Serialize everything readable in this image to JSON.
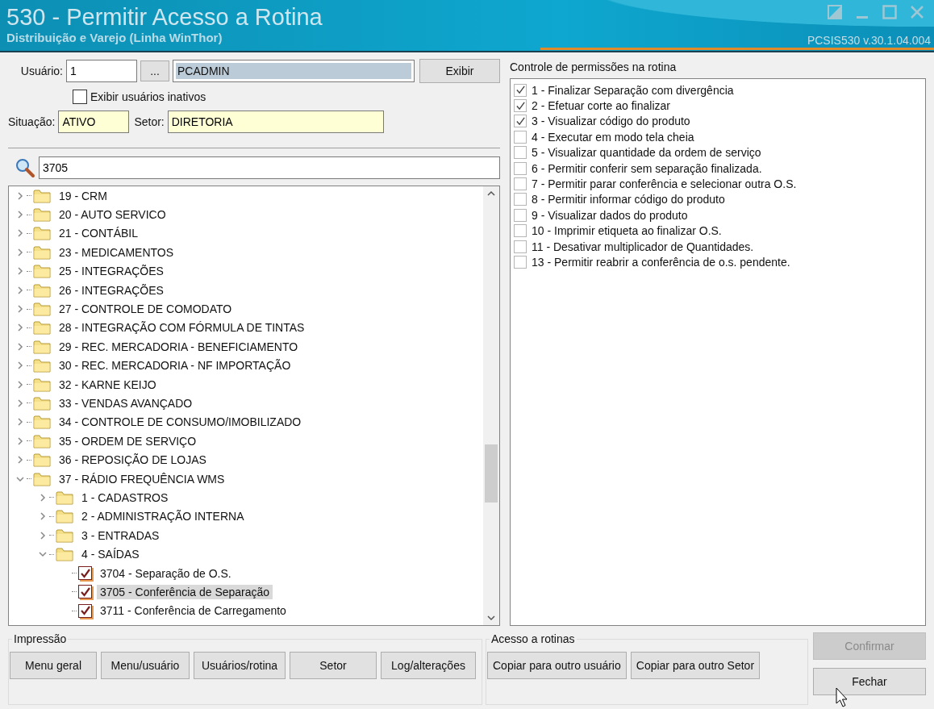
{
  "window": {
    "title": "530 - Permitir Acesso a Rotina",
    "subtitle": "Distribuição e Varejo (Linha WinThor)",
    "version": "PCSIS530  v.30.1.04.004"
  },
  "user": {
    "label": "Usuário:",
    "code": "1",
    "browse": "...",
    "name": "PCADMIN",
    "show_button": "Exibir"
  },
  "inactive": {
    "label": "Exibir usuários inativos",
    "checked": false
  },
  "status": {
    "label": "Situação:",
    "value": "ATIVO"
  },
  "sector": {
    "label": "Setor:",
    "value": "DIRETORIA"
  },
  "search": {
    "value": "3705"
  },
  "tree": [
    {
      "kind": "folder",
      "label": "19 - CRM",
      "expanded": false
    },
    {
      "kind": "folder",
      "label": "20 - AUTO SERVICO",
      "expanded": false
    },
    {
      "kind": "folder",
      "label": "21 - CONTÁBIL",
      "expanded": false
    },
    {
      "kind": "folder",
      "label": "23 - MEDICAMENTOS",
      "expanded": false
    },
    {
      "kind": "folder",
      "label": "25 - INTEGRAÇÕES",
      "expanded": false
    },
    {
      "kind": "folder",
      "label": "26 - INTEGRAÇÕES",
      "expanded": false
    },
    {
      "kind": "folder",
      "label": "27 - CONTROLE DE COMODATO",
      "expanded": false
    },
    {
      "kind": "folder",
      "label": "28 - INTEGRAÇÃO COM FÓRMULA DE TINTAS",
      "expanded": false
    },
    {
      "kind": "folder",
      "label": "29 - REC. MERCADORIA - BENEFICIAMENTO",
      "expanded": false
    },
    {
      "kind": "folder",
      "label": "30 - REC. MERCADORIA - NF IMPORTAÇÃO",
      "expanded": false
    },
    {
      "kind": "folder",
      "label": "32 - KARNE KEIJO",
      "expanded": false
    },
    {
      "kind": "folder",
      "label": "33 - VENDAS AVANÇADO",
      "expanded": false
    },
    {
      "kind": "folder",
      "label": "34 - CONTROLE DE CONSUMO/IMOBILIZADO",
      "expanded": false
    },
    {
      "kind": "folder",
      "label": "35 - ORDEM DE SERVIÇO",
      "expanded": false
    },
    {
      "kind": "folder",
      "label": "36 - REPOSIÇÃO DE LOJAS",
      "expanded": false
    },
    {
      "kind": "folder",
      "label": "37 - RÁDIO FREQUÊNCIA WMS",
      "expanded": true,
      "children": [
        {
          "kind": "folder",
          "label": "1 - CADASTROS",
          "expanded": false
        },
        {
          "kind": "folder",
          "label": "2 - ADMINISTRAÇÃO INTERNA",
          "expanded": false
        },
        {
          "kind": "folder",
          "label": "3 - ENTRADAS",
          "expanded": false
        },
        {
          "kind": "folder",
          "label": "4 - SAÍDAS",
          "expanded": true,
          "children": [
            {
              "kind": "routine",
              "label": "3704 - Separação de O.S.",
              "checked": true,
              "selected": false
            },
            {
              "kind": "routine",
              "label": "3705 - Conferência de Separação",
              "checked": true,
              "selected": true
            },
            {
              "kind": "routine",
              "label": "3711 - Conferência de Carregamento",
              "checked": true,
              "selected": false
            }
          ]
        }
      ]
    }
  ],
  "permissions": {
    "title": "Controle de permissões na rotina",
    "items": [
      {
        "label": "1 - Finalizar Separação com divergência",
        "checked": true
      },
      {
        "label": "2 - Efetuar corte ao finalizar",
        "checked": true
      },
      {
        "label": "3 - Visualizar código do produto",
        "checked": true
      },
      {
        "label": "4 - Executar em modo tela cheia",
        "checked": false
      },
      {
        "label": "5 - Visualizar quantidade da ordem de serviço",
        "checked": false
      },
      {
        "label": "6 - Permitir conferir sem separação finalizada.",
        "checked": false
      },
      {
        "label": "7 - Permitir parar conferência e selecionar outra O.S.",
        "checked": false
      },
      {
        "label": "8 - Permitir informar código do produto",
        "checked": false
      },
      {
        "label": "9 - Visualizar dados do produto",
        "checked": false
      },
      {
        "label": "10 - Imprimir etiqueta ao finalizar O.S.",
        "checked": false
      },
      {
        "label": "11 - Desativar multiplicador de Quantidades.",
        "checked": false
      },
      {
        "label": "13 - Permitir reabrir a conferência de o.s. pendente.",
        "checked": false
      }
    ]
  },
  "print_group": {
    "title": "Impressão",
    "buttons": [
      "Menu geral",
      "Menu/usuário",
      "Usuários/rotina",
      "Setor",
      "Log/alterações"
    ]
  },
  "access_group": {
    "title": "Acesso a rotinas",
    "buttons": [
      "Copiar para outro usuário",
      "Copiar para outro Setor"
    ]
  },
  "actions": [
    {
      "label": "Confirmar",
      "disabled": true
    },
    {
      "label": "Fechar",
      "disabled": false
    }
  ]
}
